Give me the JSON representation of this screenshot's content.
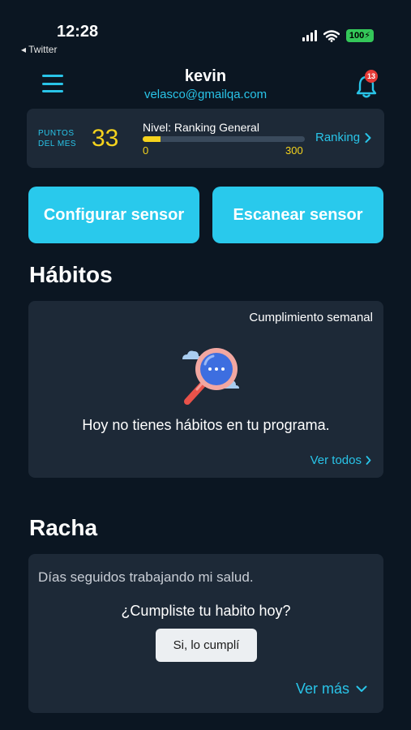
{
  "status_bar": {
    "time": "12:28",
    "back_app": "◂ Twitter",
    "battery": "100"
  },
  "header": {
    "name": "kevin",
    "email": "velasco@gmailqa.com",
    "notification_count": "13",
    "icons": [
      "menu-icon",
      "bell-icon"
    ]
  },
  "points": {
    "label_line1": "PUNTOS",
    "label_line2": "DEL MES",
    "value": "33",
    "level_label": "Nivel: Ranking General",
    "level_min": "0",
    "level_max": "300",
    "level_progress": 0.11,
    "ranking_link": "Ranking"
  },
  "actions": {
    "configure": "Configurar sensor",
    "scan": "Escanear sensor"
  },
  "habits": {
    "title": "Hábitos",
    "weekly_label": "Cumplimiento semanal",
    "empty_message": "Hoy no tienes hábitos en tu programa.",
    "see_all": "Ver todos"
  },
  "streak": {
    "title": "Racha",
    "description": "Días seguidos trabajando mi salud.",
    "question": "¿Cumpliste tu habito hoy?",
    "button": "Si, lo cumplí",
    "see_more": "Ver más"
  },
  "colors": {
    "background": "#0b1622",
    "card": "#1d2937",
    "accent": "#29c4e8",
    "points": "#f5d31d"
  }
}
